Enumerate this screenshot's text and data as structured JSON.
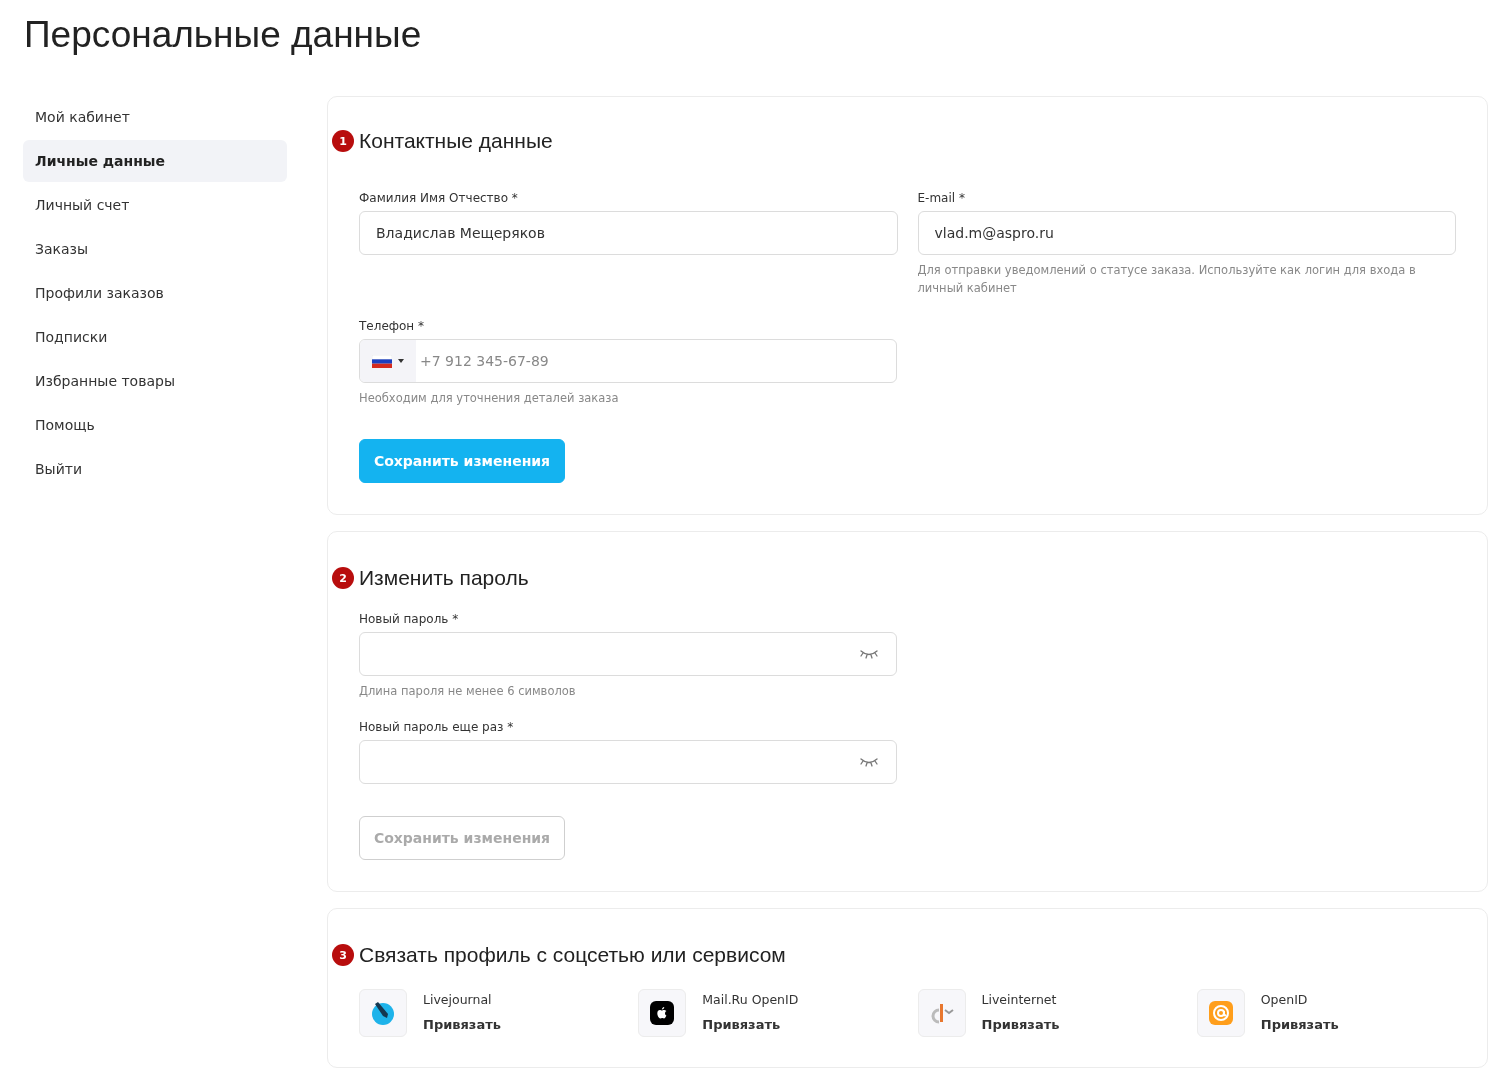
{
  "page_title": "Персональные данные",
  "sidebar": {
    "items": [
      {
        "label": "Мой кабинет",
        "selected": false
      },
      {
        "label": "Личные данные",
        "selected": true
      },
      {
        "label": "Личный счет",
        "selected": false
      },
      {
        "label": "Заказы",
        "selected": false
      },
      {
        "label": "Профили заказов",
        "selected": false
      },
      {
        "label": "Подписки",
        "selected": false
      },
      {
        "label": "Избранные товары",
        "selected": false
      },
      {
        "label": "Помощь",
        "selected": false
      },
      {
        "label": "Выйти",
        "selected": false
      }
    ]
  },
  "contact": {
    "number": "1",
    "title": "Контактные данные",
    "name_field": {
      "label": "Фамилия Имя Отчество *",
      "value": "Владислав Мещеряков"
    },
    "email_field": {
      "label": "E-mail *",
      "value": "vlad.m@aspro.ru",
      "hint": "Для отправки уведомлений о статусе заказа. Используйте как логин для входа в личный кабинет"
    },
    "phone_field": {
      "label": "Телефон *",
      "placeholder": "+7 912 345-67-89",
      "hint": "Необходим для уточнения деталей заказа"
    },
    "save_button": {
      "label": "Сохранить изменения",
      "disabled": false
    }
  },
  "password": {
    "number": "2",
    "title": "Изменить пароль",
    "fields": [
      {
        "label": "Новый пароль *",
        "hint": "Длина пароля не менее 6 символов"
      },
      {
        "label": "Новый пароль еще раз *"
      }
    ],
    "save_button": {
      "label": "Сохранить изменения",
      "disabled": true
    }
  },
  "social": {
    "number": "3",
    "title": "Связать профиль с соцсетью или сервисом",
    "services": [
      {
        "kind": "livejournal",
        "name": "Livejournal",
        "action": "Привязать"
      },
      {
        "kind": "apple",
        "name": "Mail.Ru OpenID",
        "action": "Привязать"
      },
      {
        "kind": "liveinternet",
        "name": "Liveinternet",
        "action": "Привязать"
      },
      {
        "kind": "openid",
        "name": "OpenID",
        "action": "Привязать"
      }
    ]
  }
}
